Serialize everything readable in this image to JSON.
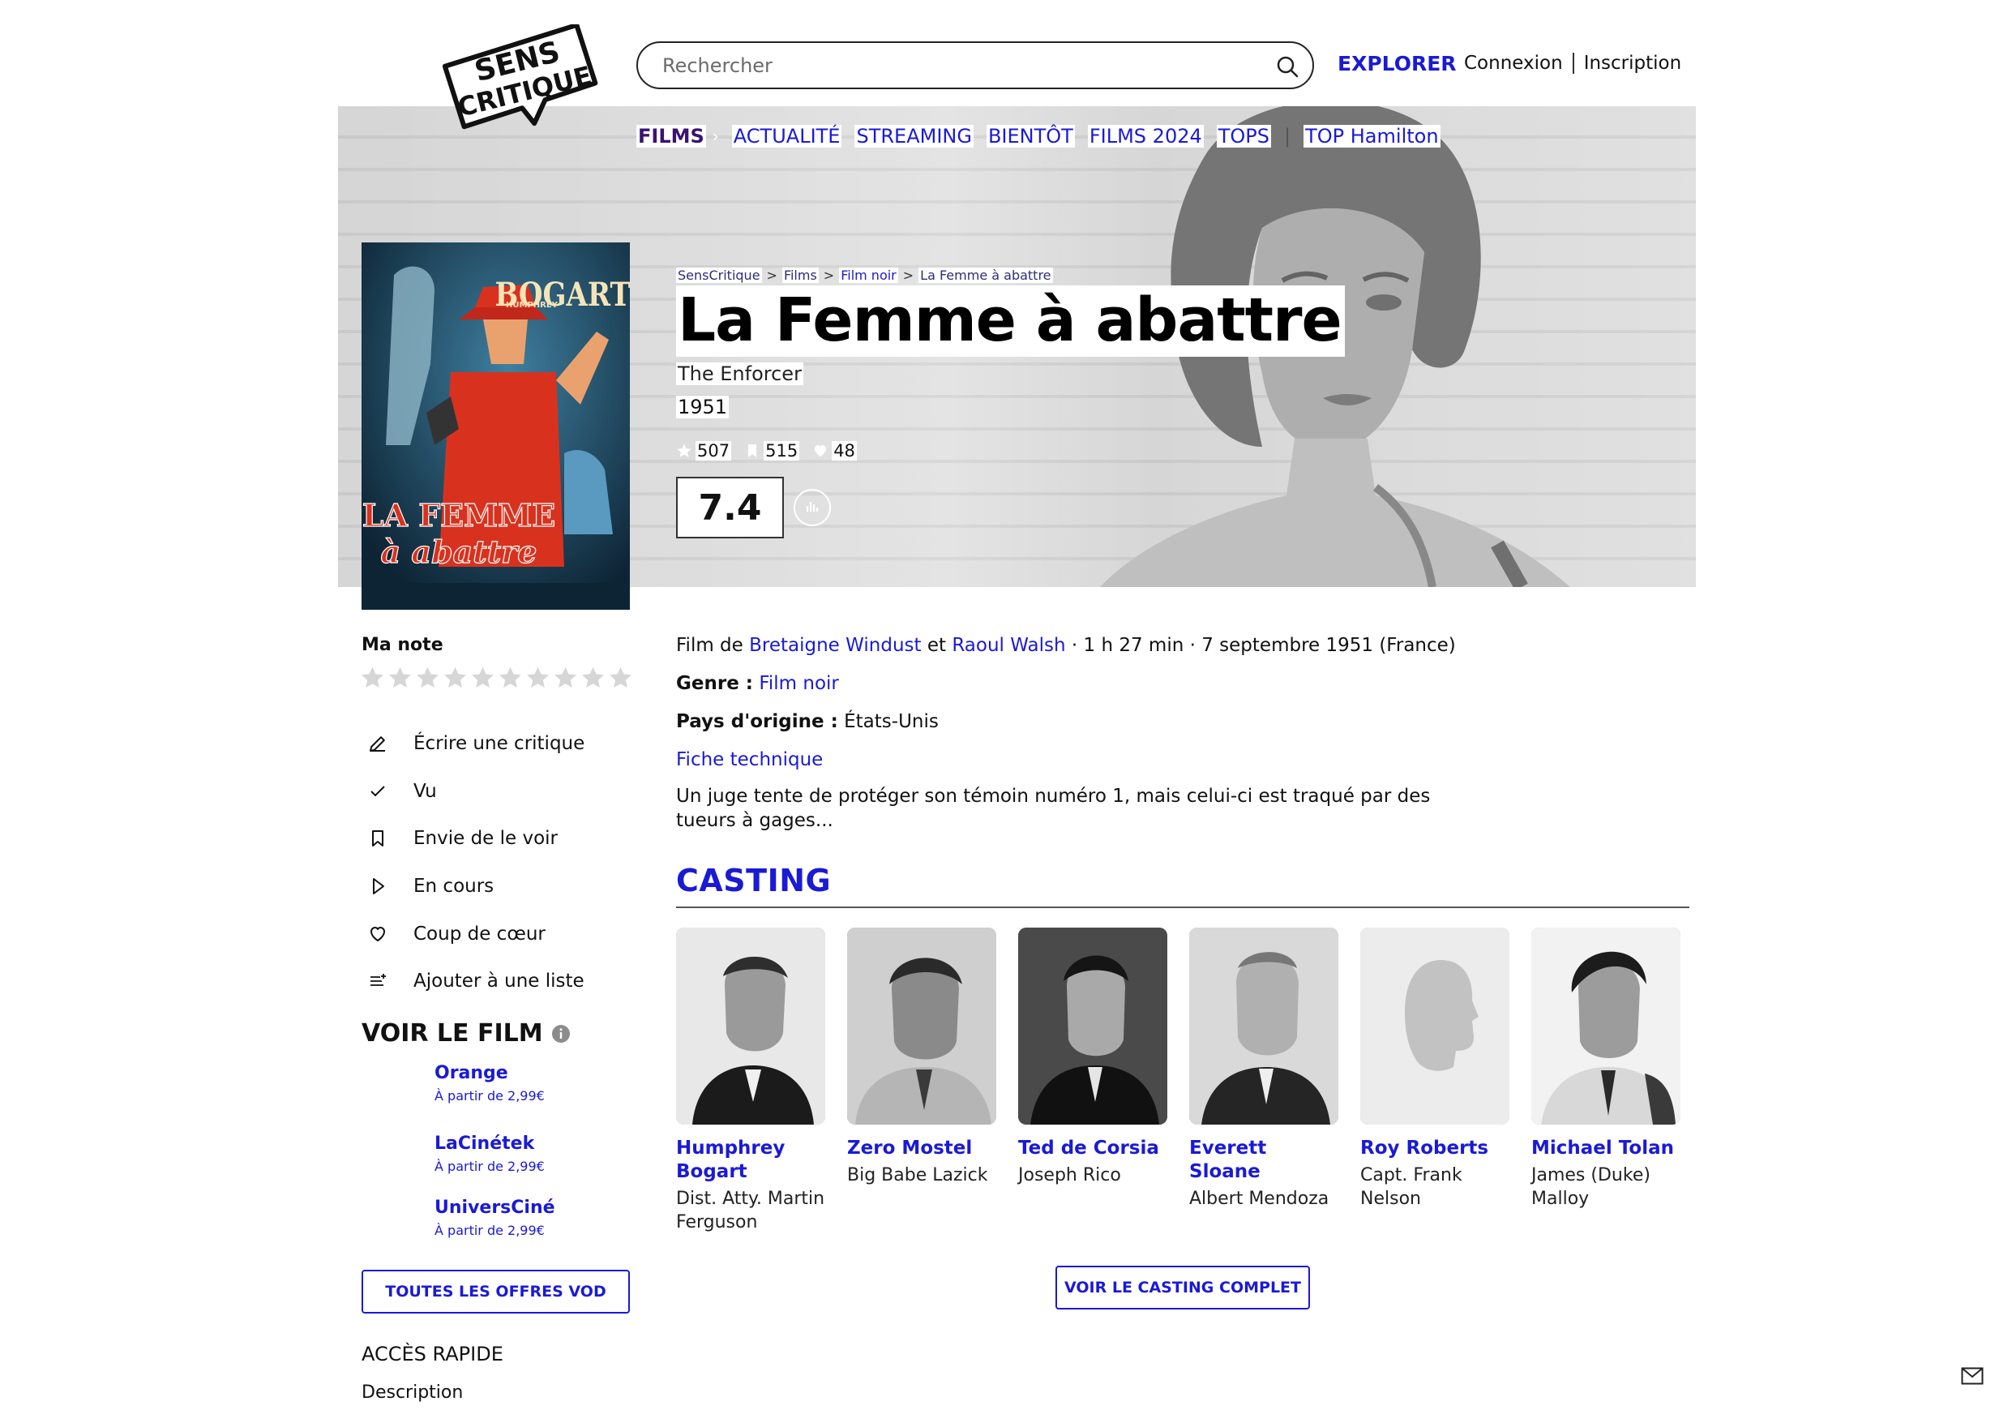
{
  "header": {
    "search_placeholder": "Rechercher",
    "explore_label": "EXPLORER",
    "login_label": "Connexion",
    "signup_label": "Inscription"
  },
  "logo": {
    "line1": "SENS",
    "line2": "CRITIQUE"
  },
  "nav": {
    "items": [
      "FILMS",
      "ACTUALITÉ",
      "STREAMING",
      "BIENTÔT",
      "FILMS 2024",
      "TOPS"
    ],
    "extra": "TOP Hamilton"
  },
  "breadcrumb": [
    "SensCritique",
    "Films",
    "Film noir",
    "La Femme à abattre"
  ],
  "movie": {
    "title": "La Femme à abattre",
    "original_title": "The Enforcer",
    "year": "1951",
    "ratings_count": "507",
    "wishlist_count": "515",
    "favorites_count": "48",
    "score": "7.4",
    "poster": {
      "actor": "BOGART",
      "actor_first": "HUMPHREY",
      "title_line1": "LA FEMME",
      "title_line2": "à abattre"
    }
  },
  "my_rating": {
    "label": "Ma note",
    "stars": 10
  },
  "actions": [
    {
      "label": "Écrire une critique",
      "icon": "pencil-icon"
    },
    {
      "label": "Vu",
      "icon": "check-icon"
    },
    {
      "label": "Envie de le voir",
      "icon": "bookmark-icon"
    },
    {
      "label": "En cours",
      "icon": "play-icon"
    },
    {
      "label": "Coup de cœur",
      "icon": "heart-icon"
    },
    {
      "label": "Ajouter à une liste",
      "icon": "list-add-icon"
    }
  ],
  "watch": {
    "title": "VOIR LE FILM",
    "offers": [
      {
        "name": "Orange",
        "price": "À partir de 2,99€"
      },
      {
        "name": "LaCinétek",
        "price": "À partir de 2,99€"
      },
      {
        "name": "UniversCiné",
        "price": "À partir de 2,99€"
      }
    ],
    "all_offers_label": "TOUTES LES OFFRES VOD"
  },
  "quick_access": {
    "title": "ACCÈS RAPIDE",
    "items": [
      "Description"
    ]
  },
  "details": {
    "film_de": "Film de",
    "director1": "Bretaigne Windust",
    "et": "et",
    "director2": "Raoul Walsh",
    "meta": "· 1 h 27 min · 7 septembre 1951 (France)",
    "genre_label": "Genre :",
    "genre": "Film noir",
    "country_label": "Pays d'origine :",
    "country": "États-Unis",
    "tech_sheet": "Fiche technique",
    "synopsis": "Un juge tente de protéger son témoin numéro 1, mais celui-ci est traqué par des tueurs à gages..."
  },
  "casting": {
    "title": "CASTING",
    "members": [
      {
        "name": "Humphrey Bogart",
        "role": "Dist. Atty. Martin Ferguson"
      },
      {
        "name": "Zero Mostel",
        "role": "Big Babe Lazick"
      },
      {
        "name": "Ted de Corsia",
        "role": "Joseph Rico"
      },
      {
        "name": "Everett Sloane",
        "role": "Albert Mendoza"
      },
      {
        "name": "Roy Roberts",
        "role": "Capt. Frank Nelson"
      },
      {
        "name": "Michael Tolan",
        "role": "James (Duke) Malloy"
      }
    ],
    "full_cast_label": "VOIR LE CASTING COMPLET"
  },
  "colors": {
    "link_blue": "#1a1ad6",
    "nav_active": "#3b1270",
    "poster_red": "#d8321e",
    "poster_bg": "#1f4e6b"
  }
}
